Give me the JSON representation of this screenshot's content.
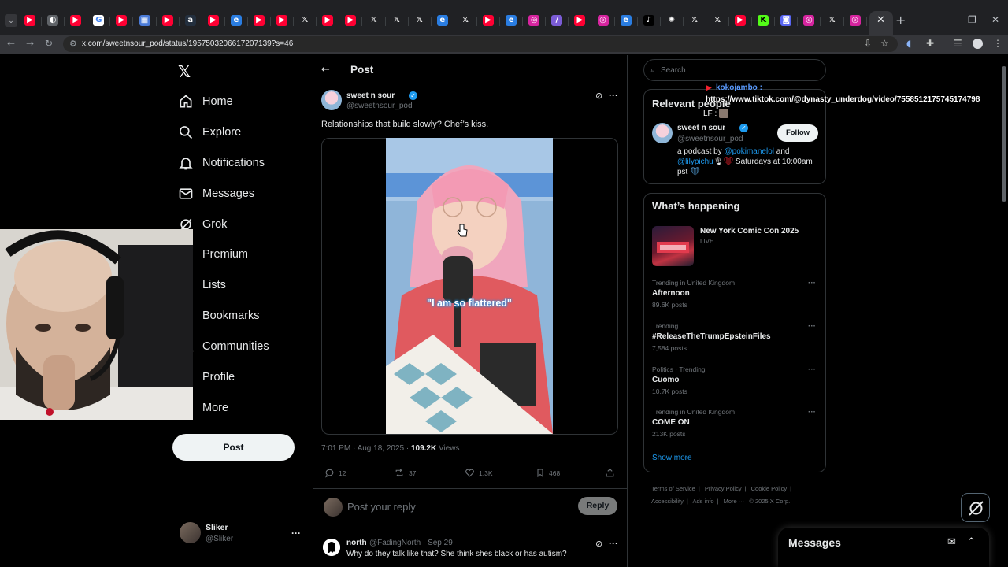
{
  "browser": {
    "url": "x.com/sweetnsour_pod/status/1957503206617207139?s=46",
    "tab_icons": [
      "youtube-icon",
      "chrome-icon",
      "youtube-icon",
      "google-icon",
      "youtube-icon",
      "extension-icon",
      "youtube-icon",
      "amazon-icon",
      "youtube-icon",
      "edge-icon",
      "youtube-icon",
      "youtube-icon",
      "x-icon",
      "youtube-icon",
      "youtube-icon",
      "x-icon",
      "x-icon",
      "x-icon",
      "edge-icon",
      "x-icon",
      "youtube-icon",
      "edge-icon",
      "instagram-icon",
      "feather-icon",
      "youtube-icon",
      "instagram-icon",
      "edge-icon",
      "tiktok-icon",
      "chatgpt-icon",
      "x-icon",
      "x-icon",
      "youtube-icon",
      "kick-icon",
      "discord-icon",
      "instagram-icon",
      "x-icon",
      "instagram-icon",
      "kick-icon"
    ]
  },
  "nav": {
    "items": [
      {
        "label": "Home",
        "icon": "home-icon"
      },
      {
        "label": "Explore",
        "icon": "search-icon"
      },
      {
        "label": "Notifications",
        "icon": "bell-icon"
      },
      {
        "label": "Messages",
        "icon": "mail-icon"
      },
      {
        "label": "Grok",
        "icon": "grok-icon"
      },
      {
        "label": "Premium",
        "icon": "premium-icon"
      },
      {
        "label": "Lists",
        "icon": "list-icon"
      },
      {
        "label": "Bookmarks",
        "icon": "bookmark-icon"
      },
      {
        "label": "Communities",
        "icon": "communities-icon"
      },
      {
        "label": "Profile",
        "icon": "profile-icon"
      },
      {
        "label": "More",
        "icon": "more-icon"
      }
    ],
    "post_button": "Post",
    "account": {
      "name": "Sliker",
      "handle": "@Sliker"
    }
  },
  "header": {
    "title": "Post"
  },
  "post": {
    "author": "sweet n sour",
    "handle": "@sweetnsour_pod",
    "text": "Relationships that build slowly? Chef’s kiss.",
    "caption": "\"I am so flattered\"",
    "time": "7:01 PM · Aug 18, 2025 · ",
    "views": "109.2K",
    "views_label": " Views",
    "stats": {
      "replies": "12",
      "reposts": "37",
      "likes": "1.3K",
      "bookmarks": "468"
    }
  },
  "reply": {
    "placeholder": "Post your reply",
    "button": "Reply"
  },
  "comment": {
    "name": "north",
    "handle": "@FadingNorth · Sep 29",
    "text": "Why do they talk like that? She think shes black or has autism?"
  },
  "sidebar": {
    "search_placeholder": "Search",
    "relevant_title": "Relevant people",
    "person": {
      "name": "sweet n sour",
      "handle": "@sweetnsour_pod",
      "follow": "Follow",
      "bio_1": "a podcast by ",
      "mention_1": "@pokimanelol",
      "bio_2": " and ",
      "mention_2": "@lilypichu",
      "bio_3": " Saturdays at 10:00am pst"
    },
    "happening_title": "What’s happening",
    "event": {
      "title": "New York Comic Con 2025",
      "status": "LIVE"
    },
    "trends": [
      {
        "context": "Trending in United Kingdom",
        "title": "Afternoon",
        "count": "89.6K posts"
      },
      {
        "context": "Trending",
        "title": "#ReleaseTheTrumpEpsteinFiles",
        "count": "7,584 posts"
      },
      {
        "context": "Politics · Trending",
        "title": "Cuomo",
        "count": "10.7K posts"
      },
      {
        "context": "Trending in United Kingdom",
        "title": "COME ON",
        "count": "213K posts"
      }
    ],
    "show_more": "Show more",
    "footer": [
      "Terms of Service",
      "|",
      "Privacy Policy",
      "|",
      "Cookie Policy",
      "|",
      "Accessibility",
      "|",
      "Ads info",
      "|",
      "More ···",
      "© 2025 X Corp."
    ]
  },
  "overlay": {
    "user": "kokojambo :",
    "message": "https://www.tiktok.com/@dynasty_underdog/video/7558512175745174798",
    "small": "LF :"
  },
  "messages_drawer": {
    "title": "Messages"
  },
  "colors": {
    "accent": "#1d9bf0",
    "background": "#000000",
    "text": "#e7e9ea",
    "muted": "#71767b",
    "border": "#2f3336"
  }
}
